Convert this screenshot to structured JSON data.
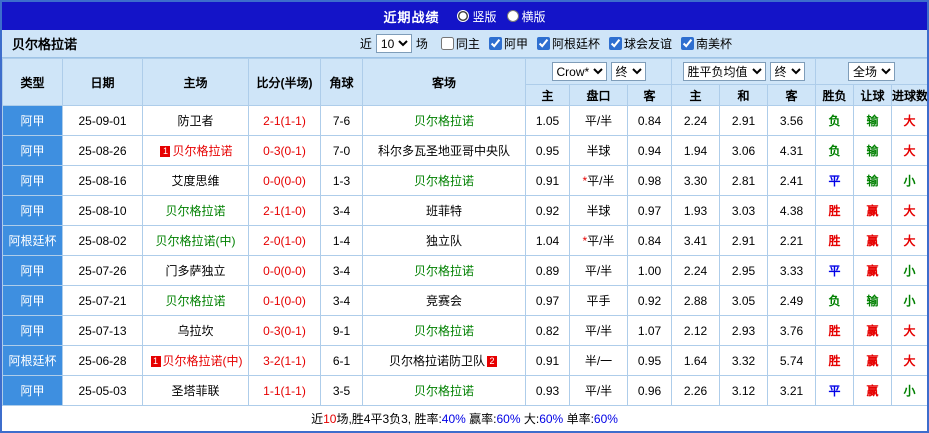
{
  "title_bar": {
    "title": "近期战绩",
    "options": [
      {
        "label": "竖版",
        "selected": true
      },
      {
        "label": "横版",
        "selected": false
      }
    ]
  },
  "filter_bar": {
    "team": "贝尔格拉诺",
    "near_label": "近",
    "count_value": "10",
    "games_label": "场",
    "checkboxes": [
      {
        "label": "同主",
        "checked": false
      },
      {
        "label": "阿甲",
        "checked": true
      },
      {
        "label": "阿根廷杯",
        "checked": true
      },
      {
        "label": "球会友谊",
        "checked": true
      },
      {
        "label": "南美杯",
        "checked": true
      }
    ]
  },
  "table": {
    "header": {
      "type": "类型",
      "date": "日期",
      "home": "主场",
      "score": "比分(半场)",
      "corner": "角球",
      "away": "客场",
      "asia_company": "Crow*",
      "asia_final": "终",
      "europe_mean": "胜平负均值",
      "europe_final": "终",
      "fulltime_scope": "全场",
      "sub_headers": [
        "主",
        "盘口",
        "客",
        "主",
        "和",
        "客",
        "胜负",
        "让球",
        "进球数"
      ]
    },
    "rows": [
      {
        "league": "阿甲",
        "date": "25-09-01",
        "home": {
          "name": "防卫者",
          "color": "black"
        },
        "score": "2-1(1-1)",
        "corner": "7-6",
        "away": {
          "name": "贝尔格拉诺",
          "color": "green"
        },
        "asia": {
          "home": "1.05",
          "handicap": "平/半",
          "star": false,
          "away": "0.84"
        },
        "europe": {
          "home": "2.24",
          "draw": "2.91",
          "away": "3.56"
        },
        "result": {
          "text": "负",
          "color": "green"
        },
        "handicap_result": {
          "text": "输",
          "color": "green"
        },
        "goals": {
          "text": "大",
          "color": "red"
        }
      },
      {
        "league": "阿甲",
        "date": "25-08-26",
        "home": {
          "name": "贝尔格拉诺",
          "color": "red",
          "badge": "1"
        },
        "score": "0-3(0-1)",
        "corner": "7-0",
        "away": {
          "name": "科尔多瓦圣地亚哥中央队",
          "color": "black"
        },
        "asia": {
          "home": "0.95",
          "handicap": "半球",
          "star": false,
          "away": "0.94"
        },
        "europe": {
          "home": "1.94",
          "draw": "3.06",
          "away": "4.31"
        },
        "result": {
          "text": "负",
          "color": "green"
        },
        "handicap_result": {
          "text": "输",
          "color": "green"
        },
        "goals": {
          "text": "大",
          "color": "red"
        }
      },
      {
        "league": "阿甲",
        "date": "25-08-16",
        "home": {
          "name": "艾度思维",
          "color": "black"
        },
        "score": "0-0(0-0)",
        "corner": "1-3",
        "away": {
          "name": "贝尔格拉诺",
          "color": "green"
        },
        "asia": {
          "home": "0.91",
          "handicap": "平/半",
          "star": true,
          "away": "0.98"
        },
        "europe": {
          "home": "3.30",
          "draw": "2.81",
          "away": "2.41"
        },
        "result": {
          "text": "平",
          "color": "blue"
        },
        "handicap_result": {
          "text": "输",
          "color": "green"
        },
        "goals": {
          "text": "小",
          "color": "green"
        }
      },
      {
        "league": "阿甲",
        "date": "25-08-10",
        "home": {
          "name": "贝尔格拉诺",
          "color": "green"
        },
        "score": "2-1(1-0)",
        "corner": "3-4",
        "away": {
          "name": "班菲特",
          "color": "black"
        },
        "asia": {
          "home": "0.92",
          "handicap": "半球",
          "star": false,
          "away": "0.97"
        },
        "europe": {
          "home": "1.93",
          "draw": "3.03",
          "away": "4.38"
        },
        "result": {
          "text": "胜",
          "color": "red"
        },
        "handicap_result": {
          "text": "赢",
          "color": "red"
        },
        "goals": {
          "text": "大",
          "color": "red"
        }
      },
      {
        "league": "阿根廷杯",
        "date": "25-08-02",
        "home": {
          "name": "贝尔格拉诺(中)",
          "color": "green"
        },
        "score": "2-0(1-0)",
        "corner": "1-4",
        "away": {
          "name": "独立队",
          "color": "black"
        },
        "asia": {
          "home": "1.04",
          "handicap": "平/半",
          "star": true,
          "away": "0.84"
        },
        "europe": {
          "home": "3.41",
          "draw": "2.91",
          "away": "2.21"
        },
        "result": {
          "text": "胜",
          "color": "red"
        },
        "handicap_result": {
          "text": "赢",
          "color": "red"
        },
        "goals": {
          "text": "大",
          "color": "red"
        }
      },
      {
        "league": "阿甲",
        "date": "25-07-26",
        "home": {
          "name": "门多萨独立",
          "color": "black"
        },
        "score": "0-0(0-0)",
        "corner": "3-4",
        "away": {
          "name": "贝尔格拉诺",
          "color": "green"
        },
        "asia": {
          "home": "0.89",
          "handicap": "平/半",
          "star": false,
          "away": "1.00"
        },
        "europe": {
          "home": "2.24",
          "draw": "2.95",
          "away": "3.33"
        },
        "result": {
          "text": "平",
          "color": "blue"
        },
        "handicap_result": {
          "text": "赢",
          "color": "red"
        },
        "goals": {
          "text": "小",
          "color": "green"
        }
      },
      {
        "league": "阿甲",
        "date": "25-07-21",
        "home": {
          "name": "贝尔格拉诺",
          "color": "green"
        },
        "score": "0-1(0-0)",
        "corner": "3-4",
        "away": {
          "name": "竞赛会",
          "color": "black"
        },
        "asia": {
          "home": "0.97",
          "handicap": "平手",
          "star": false,
          "away": "0.92"
        },
        "europe": {
          "home": "2.88",
          "draw": "3.05",
          "away": "2.49"
        },
        "result": {
          "text": "负",
          "color": "green"
        },
        "handicap_result": {
          "text": "输",
          "color": "green"
        },
        "goals": {
          "text": "小",
          "color": "green"
        }
      },
      {
        "league": "阿甲",
        "date": "25-07-13",
        "home": {
          "name": "乌拉坎",
          "color": "black"
        },
        "score": "0-3(0-1)",
        "corner": "9-1",
        "away": {
          "name": "贝尔格拉诺",
          "color": "green"
        },
        "asia": {
          "home": "0.82",
          "handicap": "平/半",
          "star": false,
          "away": "1.07"
        },
        "europe": {
          "home": "2.12",
          "draw": "2.93",
          "away": "3.76"
        },
        "result": {
          "text": "胜",
          "color": "red"
        },
        "handicap_result": {
          "text": "赢",
          "color": "red"
        },
        "goals": {
          "text": "大",
          "color": "red"
        }
      },
      {
        "league": "阿根廷杯",
        "date": "25-06-28",
        "home": {
          "name": "贝尔格拉诺(中)",
          "color": "red",
          "badge": "1"
        },
        "score": "3-2(1-1)",
        "corner": "6-1",
        "away": {
          "name": "贝尔格拉诺防卫队",
          "color": "black",
          "badge": "2"
        },
        "asia": {
          "home": "0.91",
          "handicap": "半/一",
          "star": false,
          "away": "0.95"
        },
        "europe": {
          "home": "1.64",
          "draw": "3.32",
          "away": "5.74"
        },
        "result": {
          "text": "胜",
          "color": "red"
        },
        "handicap_result": {
          "text": "赢",
          "color": "red"
        },
        "goals": {
          "text": "大",
          "color": "red"
        }
      },
      {
        "league": "阿甲",
        "date": "25-05-03",
        "home": {
          "name": "圣塔菲联",
          "color": "black"
        },
        "score": "1-1(1-1)",
        "corner": "3-5",
        "away": {
          "name": "贝尔格拉诺",
          "color": "green"
        },
        "asia": {
          "home": "0.93",
          "handicap": "平/半",
          "star": false,
          "away": "0.96"
        },
        "europe": {
          "home": "2.26",
          "draw": "3.12",
          "away": "3.21"
        },
        "result": {
          "text": "平",
          "color": "blue"
        },
        "handicap_result": {
          "text": "赢",
          "color": "red"
        },
        "goals": {
          "text": "小",
          "color": "green"
        }
      }
    ]
  },
  "footer": {
    "segments": [
      {
        "text": "近",
        "color": "black"
      },
      {
        "text": "10",
        "color": "red"
      },
      {
        "text": "场,胜4平3负3, 胜率:",
        "color": "black"
      },
      {
        "text": "40%",
        "color": "blue"
      },
      {
        "text": " 赢率:",
        "color": "black"
      },
      {
        "text": "60%",
        "color": "blue"
      },
      {
        "text": " 大:",
        "color": "black"
      },
      {
        "text": "60%",
        "color": "blue"
      },
      {
        "text": " 单率:",
        "color": "black"
      },
      {
        "text": "60%",
        "color": "blue"
      }
    ]
  },
  "color_map": {
    "black": "#000000",
    "green": "#008000",
    "red": "#e60000",
    "blue": "#0000e6"
  },
  "colors": {
    "title_bar_bg": "#1414c8",
    "panel_bg": "#cfe5f8",
    "league_cell_bg": "#3e8fe0",
    "grid_border": "#aecdea",
    "window_border": "#3d6dcc"
  }
}
